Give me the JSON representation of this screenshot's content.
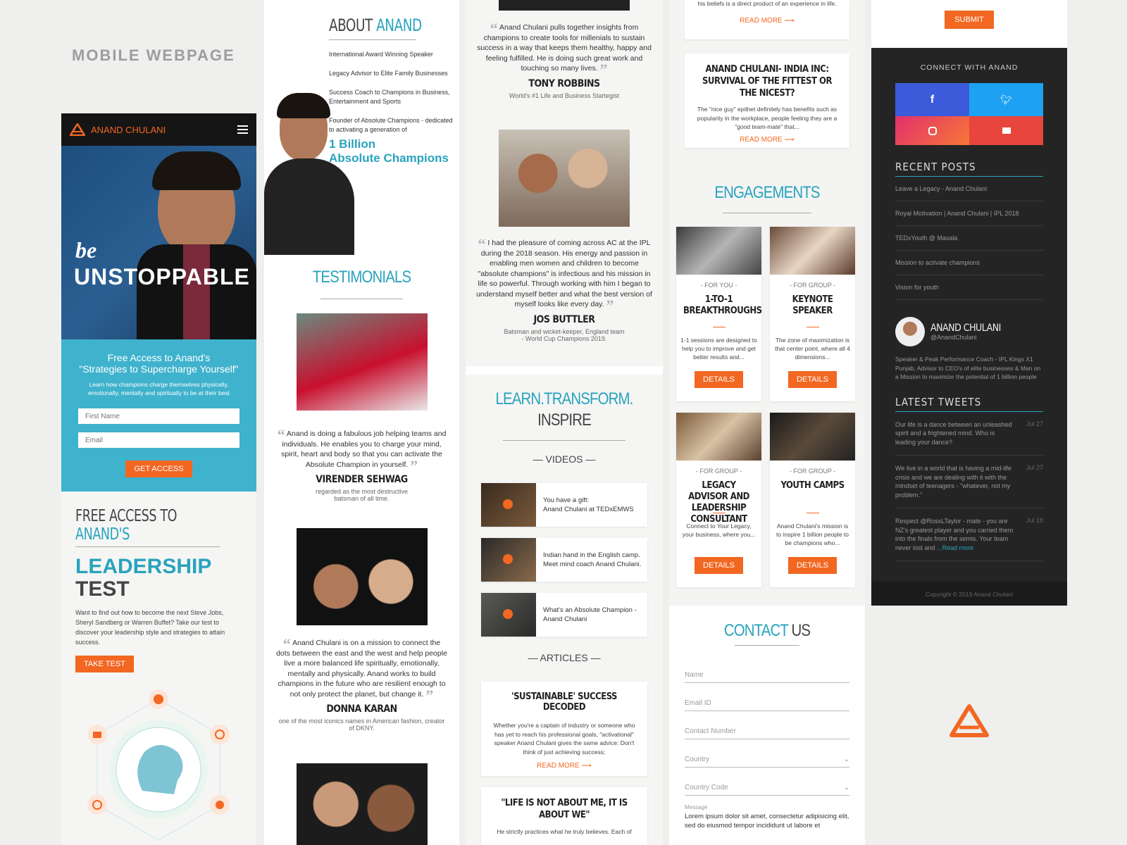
{
  "page_label": "MOBILE WEBPAGE",
  "brand": {
    "name": "ANAND CHULANI",
    "accent": "#f26722",
    "teal": "#29a3bd"
  },
  "hero": {
    "tagline_small": "be",
    "tagline_big": "UNSTOPPABLE"
  },
  "cta": {
    "title_line1": "Free Access to Anand's",
    "title_line2": "\"Strategies to Supercharge Yourself\"",
    "subtitle": "Learn how champions charge themselves physically, emotionally, mentally and spiritually to be at their best",
    "first_name_placeholder": "First Name",
    "email_placeholder": "Email",
    "button": "GET ACCESS"
  },
  "leadership": {
    "heading_a": "FREE ACCESS TO",
    "heading_b": "ANAND'S",
    "title_a": "LEADERSHIP",
    "title_b": "TEST",
    "body": "Want to find out how to become the next Steve Jobs, Sheryl Sandberg or Warren Buffet? Take our test to discover your leadership style and strategies to attain success.",
    "button": "TAKE TEST"
  },
  "about": {
    "heading_a": "ABOUT",
    "heading_b": "ANAND",
    "items": [
      "International Award Winning Speaker",
      "Legacy Advisor to Elite Family Businesses",
      "Success Coach to Champions in Business, Entertainment and Sports",
      "Founder of Absolute Champions - dedicated to activating a generation of"
    ],
    "highlight_a": "1 Billion",
    "highlight_b": "Absolute Champions"
  },
  "testimonials_heading": "TESTIMONIALS",
  "testimonials": [
    {
      "text": "Anand is doing a fabulous job helping teams and individuals. He enables you to charge your mind, spirit, heart and body so that you can activate the Absolute Champion in yourself.",
      "name": "VIRENDER SEHWAG",
      "role": "regarded as the most destructive batsman of all time."
    },
    {
      "text": "Anand Chulani is on a mission to connect the dots between the east and the west and help people live a more balanced life spiritually, emotionally, mentally and physically. Anand works to build champions in the future who are resilient enough to not only protect the planet, but change it.",
      "name": "DONNA KARAN",
      "role": "one of the most iconics names in American fashion, creator of DKNY."
    },
    {
      "text": "Anand Chulani pulls together insights from champions to create tools for millenials to sustain success in a way that keeps them healthy, happy and feeling fulfilled. He is doing such great work and touching so many lives.",
      "name": "TONY ROBBINS",
      "role": "World's #1 Life and Business Startegist"
    },
    {
      "text": "I had the pleasure of coming across AC at the IPL during the 2018 season. His energy and passion in enabling men women and children to become \"absolute champions\" is infectious and his mission in life so powerful. Through working with him I began to understand myself better and what the best version of myself looks like every day.",
      "name": "JOS BUTTLER",
      "role": "Batsman and wicket-keeper, England team - World Cup Champions 2019."
    }
  ],
  "learn": {
    "heading_a": "LEARN.TRANSFORM.",
    "heading_b": "INSPIRE",
    "videos_label": "VIDEOS",
    "videos": [
      {
        "line1": "You have a gift:",
        "line2": "Anand Chulani at TEDxEMWS"
      },
      {
        "line1": "Indian hand in the English camp.",
        "line2": "Meet mind coach Anand Chulani."
      },
      {
        "line1": "What's an Absolute Champion -",
        "line2": "Anand Chulani"
      }
    ],
    "articles_label": "ARTICLES",
    "articles": [
      {
        "title": "'SUSTAINABLE' SUCCESS DECODED",
        "text": "Whether you're a captain of industry or someone who has yet to reach his professional goals, \"activational\" speaker Anand Chulani gives the same advice: Don't think of just achieving success;",
        "link": "READ MORE"
      },
      {
        "title": "\"LIFE IS NOT ABOUT ME, IT IS ABOUT WE\"",
        "text": "He strictly practices what he truly believes. Each of",
        "link": ""
      }
    ]
  },
  "col4": {
    "top_text": "his beliefs is a direct product of an experience in life.",
    "top_link": "READ MORE",
    "article_title": "ANAND CHULANI- INDIA INC: SURVIVAL OF THE FITTEST OR THE NICEST?",
    "article_text": "The \"nice guy\" epithet definitely has benefits such as popularity in the workplace, people feeling they are a \"good team-mate\" that...",
    "article_link": "READ MORE",
    "engagements_heading": "ENGAGEMENTS",
    "engagements": [
      {
        "tag": "- FOR YOU -",
        "title": "1-TO-1 BREAKTHROUGHS",
        "text": "1-1 sessions are designed to help you to improve and get better results and...",
        "button": "DETAILS"
      },
      {
        "tag": "- FOR GROUP -",
        "title": "KEYNOTE SPEAKER",
        "text": "The zone of maximization is that center point, where all 4 dimensions...",
        "button": "DETAILS"
      },
      {
        "tag": "- FOR GROUP -",
        "title": "LEGACY ADVISOR AND LEADERSHIP CONSULTANT",
        "text": "Connect to Your Legacy, your business, where you...",
        "button": "DETAILS"
      },
      {
        "tag": "- FOR GROUP -",
        "title": "YOUTH CAMPS",
        "text": "Anand Chulani's mission is to inspire 1 billion people to be champions who...",
        "button": "DETAILS"
      }
    ],
    "contact_heading_a": "CONTACT",
    "contact_heading_b": "US",
    "contact_fields": [
      "Name",
      "Email ID",
      "Contact Number",
      "Country",
      "Country Code"
    ],
    "message_label": "Message",
    "message_text": "Lorem ipsum dolor sit amet, consectetur adipisicing elit, sed do eiusmod tempor incididunt ut labore et"
  },
  "col5": {
    "submit": "SUBMIT",
    "connect": "CONNECT WITH ANAND",
    "recent_posts_heading": "RECENT POSTS",
    "recent_posts": [
      "Leave a Legacy - Anand Chulani",
      "Royal Motivation | Anand Chulani | IPL 2018",
      "TEDxYouth @ Masala",
      "Mission to activate champions",
      "Vision for youth"
    ],
    "profile_name": "ANAND CHULANI",
    "profile_handle": "@AnandChulani",
    "profile_bio": "Speaker & Peak Performance Coach - IPL Kings X1 Punjab, Advisor to CEO's of elite businesses & Man on a Mission to maximize the potential of 1 billion people",
    "latest_tweets_heading": "LATEST TWEETS",
    "tweets": [
      {
        "text": "Our life is a dance between an unleashed spirit and a frightened mind. Who is leading your dance?",
        "date": "Jul 27",
        "more": ""
      },
      {
        "text": "We live in a world that is having a mid-life crisis and we are dealing with it with the mindset of teenagers - \"whatever, not my problem.\"",
        "date": "Jul 27",
        "more": ""
      },
      {
        "text": "Respect @RossLTaylor - mate - you are NZ's greatest player and you carried them into the finals from the semis. Your team never lost and",
        "date": "Jul 18",
        "more": "...Read more"
      }
    ],
    "copyright": "Copyright © 2019 Anand Chulani"
  }
}
